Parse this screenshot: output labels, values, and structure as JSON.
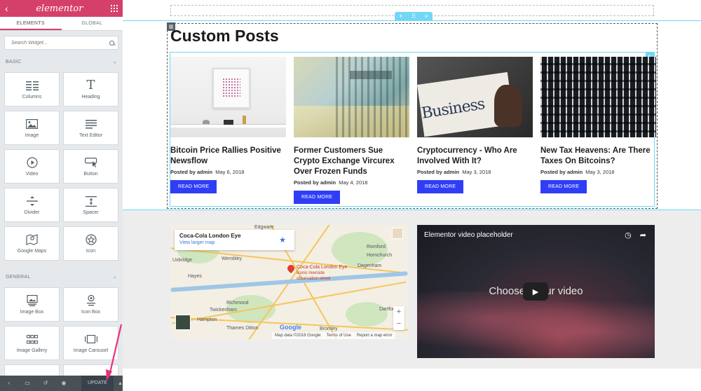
{
  "sidebar": {
    "logo": "elementor",
    "tabs": [
      {
        "label": "ELEMENTS"
      },
      {
        "label": "GLOBAL"
      }
    ],
    "search": {
      "placeholder": "Search Widget..."
    },
    "sections": [
      {
        "title": "BASIC",
        "widgets": [
          {
            "label": "Columns",
            "icon": "columns-icon"
          },
          {
            "label": "Heading",
            "icon": "heading-icon"
          },
          {
            "label": "Image",
            "icon": "image-icon"
          },
          {
            "label": "Text Editor",
            "icon": "text-editor-icon"
          },
          {
            "label": "Video",
            "icon": "video-icon"
          },
          {
            "label": "Button",
            "icon": "button-icon"
          },
          {
            "label": "Divider",
            "icon": "divider-icon"
          },
          {
            "label": "Spacer",
            "icon": "spacer-icon"
          },
          {
            "label": "Google Maps",
            "icon": "google-maps-icon"
          },
          {
            "label": "Icon",
            "icon": "star-icon"
          }
        ]
      },
      {
        "title": "GENERAL",
        "widgets": [
          {
            "label": "Image Box",
            "icon": "image-box-icon"
          },
          {
            "label": "Icon Box",
            "icon": "icon-box-icon"
          },
          {
            "label": "Image Gallery",
            "icon": "image-gallery-icon"
          },
          {
            "label": "Image Carousel",
            "icon": "image-carousel-icon"
          }
        ]
      }
    ],
    "footer": {
      "update_label": "UPDATE"
    }
  },
  "canvas": {
    "posts_title": "Custom Posts",
    "posts": [
      {
        "title": "Bitcoin Price Rallies Positive Newsflow",
        "author_prefix": "Posted by",
        "author": "admin",
        "date": "May 6, 2018",
        "button": "READ MORE"
      },
      {
        "title": "Former Customers Sue Crypto Exchange Vircurex Over Frozen Funds",
        "author_prefix": "Posted by",
        "author": "admin",
        "date": "May 4, 2018",
        "button": "READ MORE"
      },
      {
        "title": "Cryptocurrency - Who Are Involved With It?",
        "author_prefix": "Posted by",
        "author": "admin",
        "date": "May 3, 2018",
        "button": "READ MORE"
      },
      {
        "title": "New Tax Heavens: Are There Taxes On Bitcoins?",
        "author_prefix": "Posted by",
        "author": "admin",
        "date": "May 3, 2018",
        "button": "READ MORE"
      }
    ],
    "post3_thumb_word": "Business",
    "map": {
      "place": "Coca-Cola London Eye",
      "link": "View larger map",
      "pin_label_1": "Coca-Cola London Eye",
      "pin_label_2": "Iconic riverside",
      "pin_label_3": "observation wheel",
      "labels": [
        "Edgware",
        "Romford",
        "Hornchurch",
        "Wembley",
        "Uxbridge",
        "Dagenham",
        "Hayes",
        "Richmond",
        "Twickenham",
        "Hampton",
        "Thames Ditton",
        "Bromley",
        "Dartford"
      ],
      "google": "Google",
      "footer": [
        "Map data ©2018 Google",
        "Terms of Use",
        "Report a map error"
      ]
    },
    "video": {
      "title": "Elementor video placeholder",
      "text_left": "Choose",
      "text_right": "ur video"
    }
  },
  "colors": {
    "brand": "#d5406a",
    "accent": "#71d7f7",
    "button": "#2f3ef6",
    "annotation": "#e8327c"
  }
}
